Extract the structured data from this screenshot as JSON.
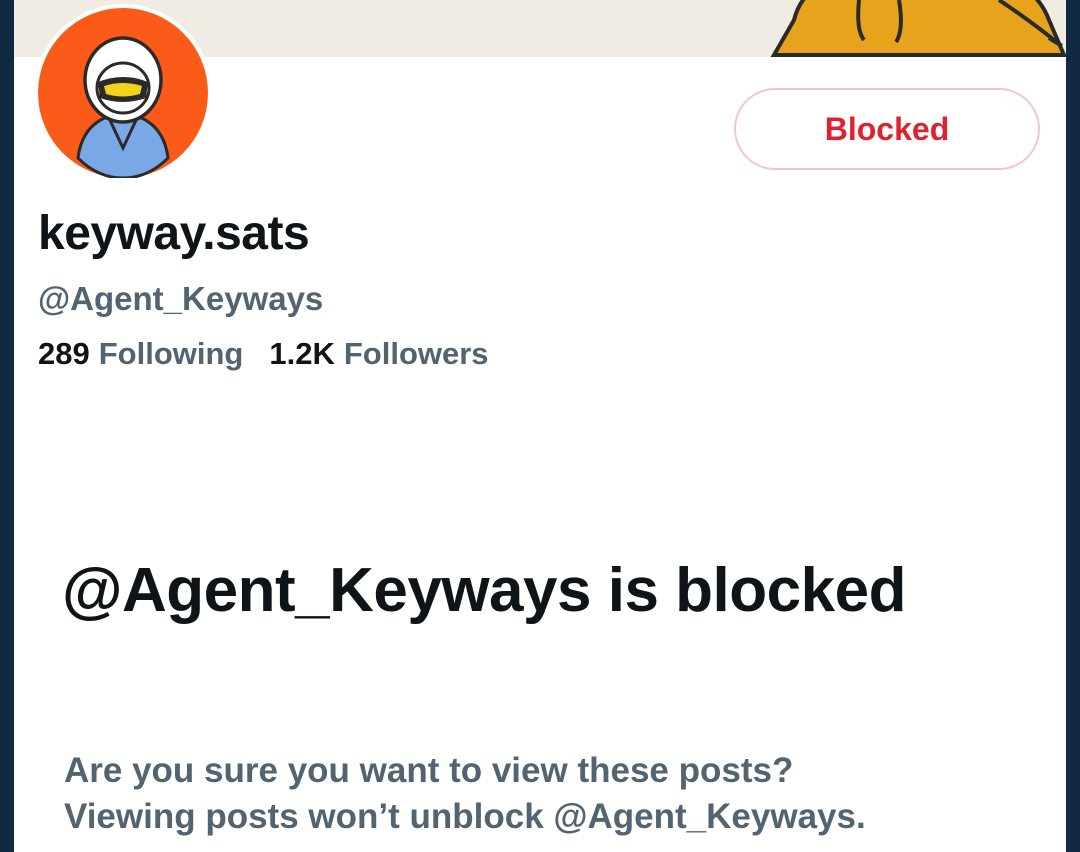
{
  "profile": {
    "display_name": "keyway.sats",
    "handle": "@Agent_Keyways",
    "following_count": "289",
    "following_label": "Following",
    "followers_count": "1.2K",
    "followers_label": "Followers"
  },
  "actions": {
    "blocked_label": "Blocked"
  },
  "blocked_notice": {
    "title": "@Agent_Keyways is blocked",
    "line1": "Are you sure you want to view these posts?",
    "line2": "Viewing posts won’t unblock @Agent_Keyways."
  },
  "colors": {
    "blocked_red": "#e0212f",
    "secondary_text": "#536471",
    "primary_text": "#0f1419",
    "avatar_orange": "#fb5b19"
  }
}
